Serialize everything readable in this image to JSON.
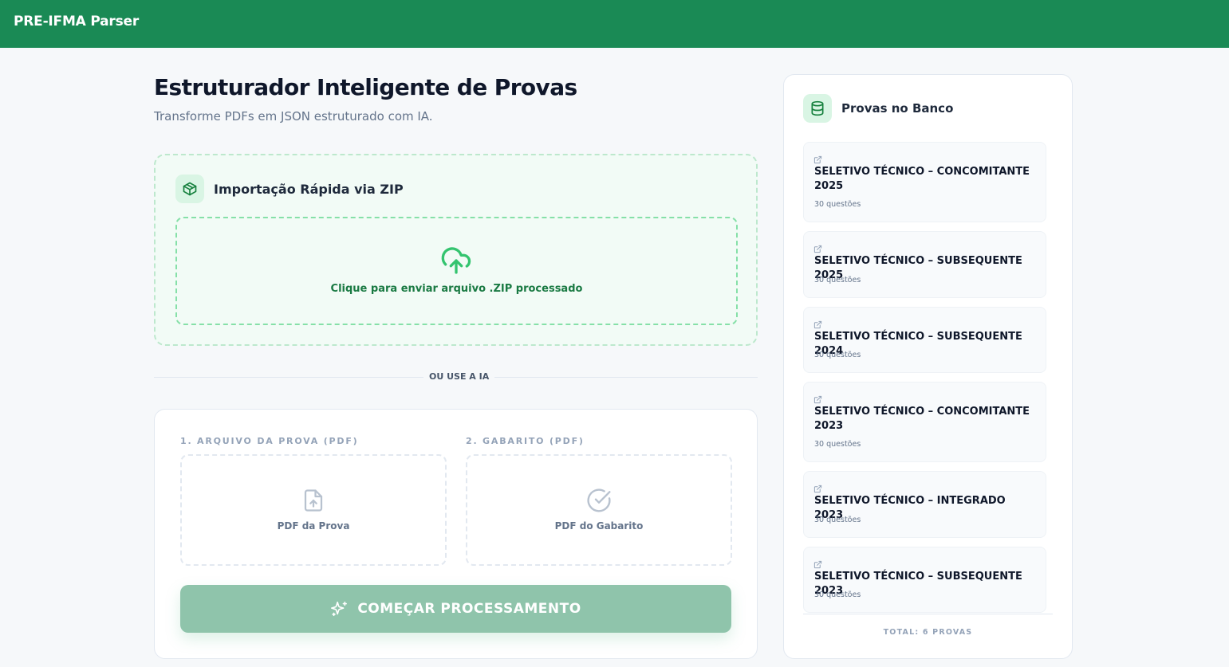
{
  "app": {
    "title": "PRE-IFMA Parser"
  },
  "main": {
    "title": "Estruturador Inteligente de Provas",
    "subtitle": "Transforme PDFs em JSON estruturado com IA."
  },
  "zip": {
    "title": "Importação Rápida via ZIP",
    "dropzone_label": "Clique para enviar arquivo .ZIP processado",
    "icon": "package-icon",
    "upload_icon": "cloud-upload-icon"
  },
  "divider": {
    "label": "OU USE A IA"
  },
  "ai": {
    "exam_field_label": "1. ARQUIVO DA PROVA (PDF)",
    "exam_drop_label": "PDF da Prova",
    "answer_field_label": "2. GABARITO (PDF)",
    "answer_drop_label": "PDF do Gabarito",
    "start_button": "COMEÇAR PROCESSAMENTO"
  },
  "sidebar": {
    "title": "Provas no Banco",
    "icon": "database-icon",
    "items": [
      {
        "name": "SELETIVO TÉCNICO – CONCOMITANTE 2025",
        "count": "30 questões"
      },
      {
        "name": "SELETIVO TÉCNICO – SUBSEQUENTE 2025",
        "count": "30 questões"
      },
      {
        "name": "SELETIVO TÉCNICO – SUBSEQUENTE 2024",
        "count": "30 questões"
      },
      {
        "name": "SELETIVO TÉCNICO – CONCOMITANTE 2023",
        "count": "30 questões"
      },
      {
        "name": "SELETIVO TÉCNICO – INTEGRADO 2023",
        "count": "30 questões"
      },
      {
        "name": "SELETIVO TÉCNICO – SUBSEQUENTE 2023",
        "count": "30 questões"
      }
    ],
    "total": "TOTAL: 6 PROVAS"
  },
  "colors": {
    "brand": "#1a8a55",
    "accent_light": "#d9f5e4",
    "button_disabled": "#8fc4ab"
  }
}
